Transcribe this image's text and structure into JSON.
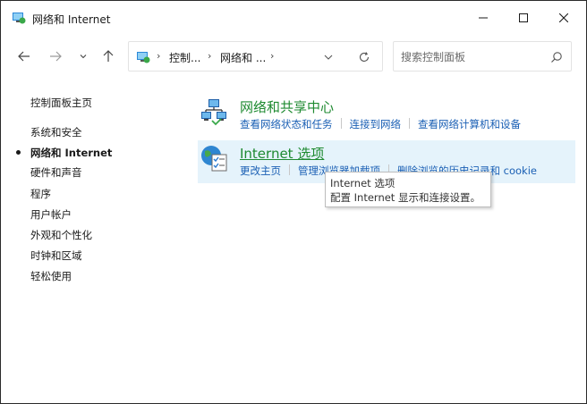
{
  "window": {
    "title": "网络和 Internet",
    "controls": {
      "minimize": "minimize-icon",
      "maximize": "maximize-icon",
      "close": "close-icon"
    }
  },
  "nav": {
    "back_icon": "arrow-left-icon",
    "forward_icon": "arrow-right-icon",
    "recent_icon": "chevron-down-icon",
    "up_icon": "arrow-up-icon"
  },
  "address": {
    "crumbs": [
      "控制...",
      "网络和 ..."
    ],
    "separator": "›"
  },
  "search": {
    "placeholder": "搜索控制面板"
  },
  "sidebar": {
    "items": [
      {
        "label": "控制面板主页",
        "active": false
      },
      {
        "label": "系统和安全",
        "active": false
      },
      {
        "label": "网络和 Internet",
        "active": true
      },
      {
        "label": "硬件和声音",
        "active": false
      },
      {
        "label": "程序",
        "active": false
      },
      {
        "label": "用户帐户",
        "active": false
      },
      {
        "label": "外观和个性化",
        "active": false
      },
      {
        "label": "时钟和区域",
        "active": false
      },
      {
        "label": "轻松使用",
        "active": false
      }
    ]
  },
  "categories": [
    {
      "title": "网络和共享中心",
      "icon": "network-sharing-icon",
      "links": [
        "查看网络状态和任务",
        "连接到网络",
        "查看网络计算机和设备"
      ]
    },
    {
      "title": "Internet 选项",
      "icon": "internet-options-icon",
      "links": [
        "更改主页",
        "管理浏览器加载项",
        "删除浏览的历史记录和 cookie"
      ]
    }
  ],
  "tooltip": {
    "title": "Internet 选项",
    "description": "配置 Internet 显示和连接设置。"
  },
  "colors": {
    "link": "#1a5fb4",
    "category_title": "#1e8a30",
    "hover_bg": "#e5f3fb"
  }
}
